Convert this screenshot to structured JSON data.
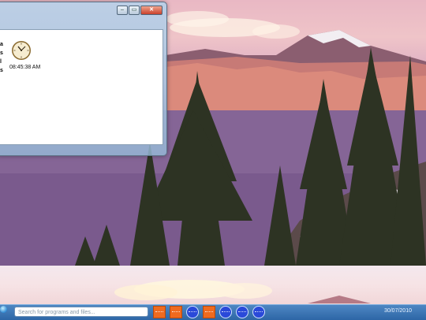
{
  "window": {
    "controls": [
      "–",
      "▭",
      "✕"
    ],
    "clock": {
      "time": "08:45:38 AM"
    },
    "side_letters": [
      "a",
      "s",
      "l",
      "s"
    ]
  },
  "taskbar": {
    "search_placeholder": "Search for programs and files...",
    "date": "30/07/2010",
    "buttons": [
      "square",
      "square",
      "circle",
      "square",
      "circle",
      "circle",
      "circle"
    ]
  },
  "colors": {
    "taskbar": "#3b74b5",
    "orange_button": "#ef6a1f",
    "blue_button": "#2a49d9"
  }
}
